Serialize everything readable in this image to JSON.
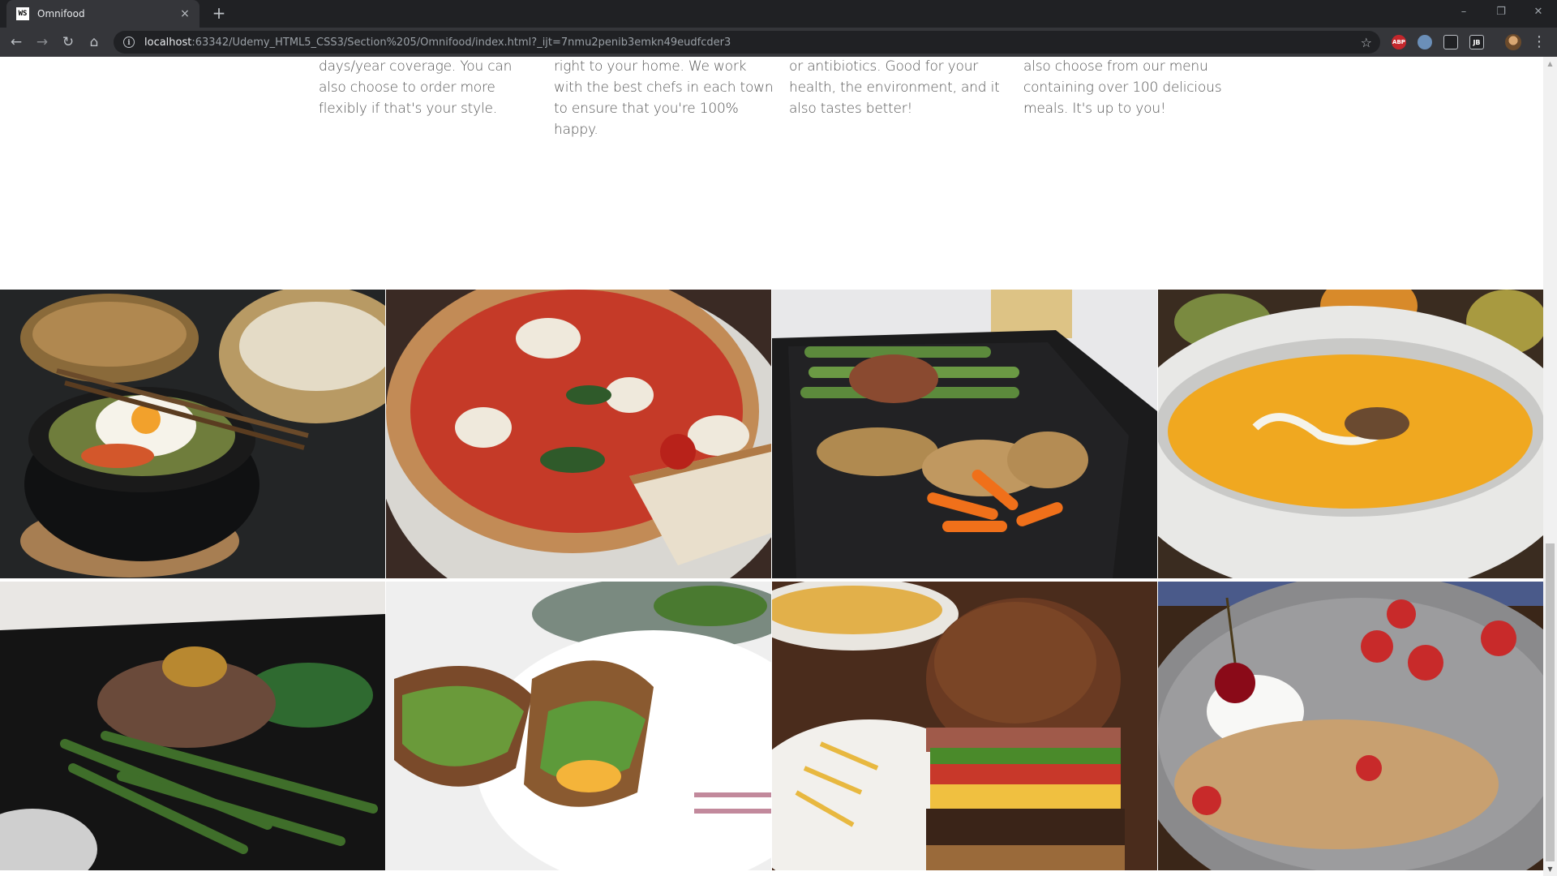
{
  "browser": {
    "tab_title": "Omnifood",
    "tab_favicon": "WS",
    "tab_close": "×",
    "new_tab": "+",
    "window_minimize": "–",
    "window_restore": "❐",
    "window_close": "✕",
    "url_host": "localhost",
    "url_rest": ":63342/Udemy_HTML5_CSS3/Section%205/Omnifood/index.html?_ijt=7nmu2penib3emkn49eudfcder3",
    "extensions": [
      "ABP",
      "",
      "",
      "JB"
    ]
  },
  "features": [
    {
      "text": "days/year coverage. You can also choose to order more flexibly if that's your style."
    },
    {
      "text": "right to your home. We work with the best chefs in each town to ensure that you're 100% happy."
    },
    {
      "text": "or antibiotics. Good for your health, the environment, and it also tastes better!"
    },
    {
      "text": "also choose from our menu containing over 100 delicious meals. It's up to you!"
    }
  ],
  "gallery": {
    "photos": [
      "bibimbap-dumplings",
      "pizza",
      "asparagus-chicken",
      "pumpkin-soup",
      "steak-green-beans",
      "sandwich",
      "burger-fries",
      "granola-berries"
    ]
  },
  "colors": {
    "chrome_dark": "#202124",
    "chrome_tab": "#35363a",
    "body_text": "#555555"
  }
}
